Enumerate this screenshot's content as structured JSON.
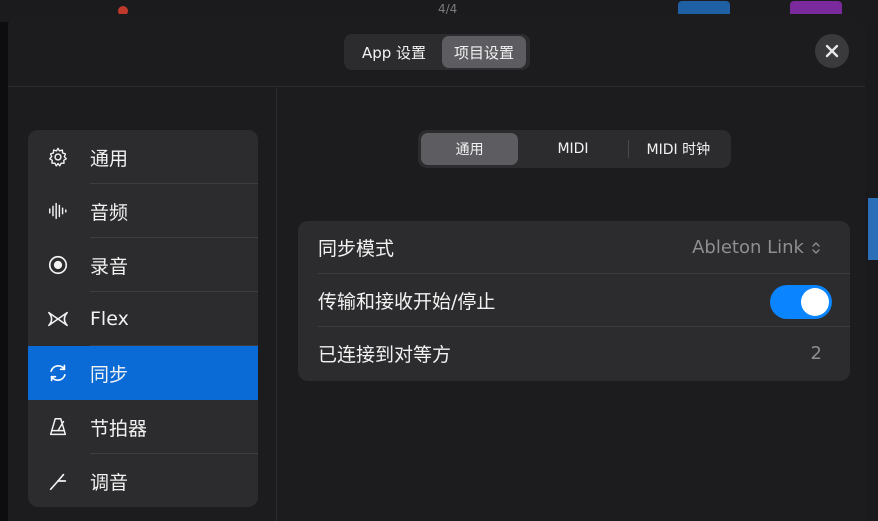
{
  "header": {
    "tabs": [
      {
        "label": "App 设置",
        "selected": false
      },
      {
        "label": "项目设置",
        "selected": true
      }
    ],
    "close_icon": "close-icon"
  },
  "background": {
    "time_signature": "4/4"
  },
  "sidebar": {
    "items": [
      {
        "label": "通用",
        "icon": "gear-icon",
        "selected": false
      },
      {
        "label": "音频",
        "icon": "waveform-icon",
        "selected": false
      },
      {
        "label": "录音",
        "icon": "record-icon",
        "selected": false
      },
      {
        "label": "Flex",
        "icon": "flex-icon",
        "selected": false
      },
      {
        "label": "同步",
        "icon": "sync-icon",
        "selected": true
      },
      {
        "label": "节拍器",
        "icon": "metronome-icon",
        "selected": false
      },
      {
        "label": "调音",
        "icon": "tuning-icon",
        "selected": false
      }
    ]
  },
  "main": {
    "tabs": [
      {
        "label": "通用",
        "selected": true
      },
      {
        "label": "MIDI",
        "selected": false
      },
      {
        "label": "MIDI 时钟",
        "selected": false
      }
    ],
    "settings": {
      "sync_mode_label": "同步模式",
      "sync_mode_value": "Ableton Link",
      "start_stop_label": "传输和接收开始/停止",
      "start_stop_enabled": true,
      "peers_label": "已连接到对等方",
      "peers_value": "2"
    }
  },
  "colors": {
    "accent": "#0a84ff",
    "selected_row": "#0a6bd6",
    "panel": "#2c2c2e",
    "modal": "#1c1c1e"
  }
}
